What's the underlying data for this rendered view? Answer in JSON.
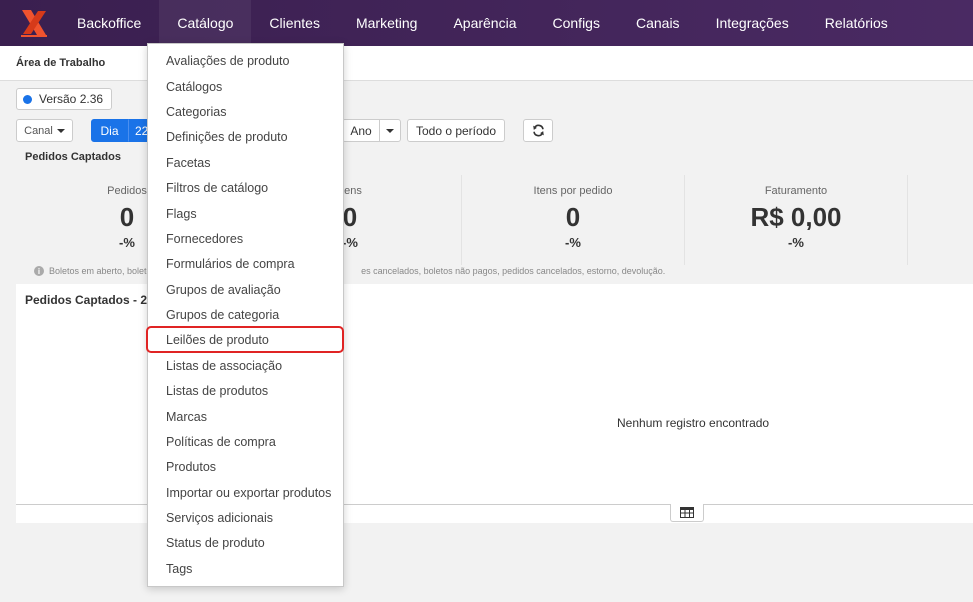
{
  "nav": {
    "items": [
      "Backoffice",
      "Catálogo",
      "Clientes",
      "Marketing",
      "Aparência",
      "Configs",
      "Canais",
      "Integrações",
      "Relatórios"
    ],
    "active_index": 1
  },
  "breadcrumb": "Área de Trabalho",
  "version": "Versão 2.36",
  "filters": {
    "channel": "Canal",
    "day": "Dia",
    "date_partial": "22",
    "year": "Ano",
    "period": "Todo o período"
  },
  "section_title": "Pedidos Captados",
  "stats": [
    {
      "label": "Pedidos",
      "value": "0",
      "pct": "-%"
    },
    {
      "label": "Itens",
      "value": "0",
      "pct": "-%"
    },
    {
      "label": "Itens por pedido",
      "value": "0",
      "pct": "-%"
    },
    {
      "label": "Faturamento",
      "value": "R$ 0,00",
      "pct": "-%"
    }
  ],
  "info_note": {
    "left": "Boletos em aberto, boletos",
    "right": "es cancelados, boletos não pagos, pedidos cancelados, estorno, devolução."
  },
  "panel": {
    "title": "Pedidos Captados - 22",
    "empty": "Nenhum registro encontrado"
  },
  "dropdown": {
    "items": [
      "Avaliações de produto",
      "Catálogos",
      "Categorias",
      "Definições de produto",
      "Facetas",
      "Filtros de catálogo",
      "Flags",
      "Fornecedores",
      "Formulários de compra",
      "Grupos de avaliação",
      "Grupos de categoria",
      "Leilões de produto",
      "Listas de associação",
      "Listas de produtos",
      "Marcas",
      "Políticas de compra",
      "Produtos",
      "Importar ou exportar produtos",
      "Serviços adicionais",
      "Status de produto",
      "Tags"
    ],
    "highlighted_index": 11
  },
  "colors": {
    "navbar": "#3f2357",
    "primary": "#1a73e8",
    "highlight": "#e02424",
    "logo": "#f0532e"
  },
  "icons": {
    "logo": "brand-logo-icon",
    "refresh": "refresh-icon",
    "table": "table-icon",
    "info": "info-icon"
  }
}
